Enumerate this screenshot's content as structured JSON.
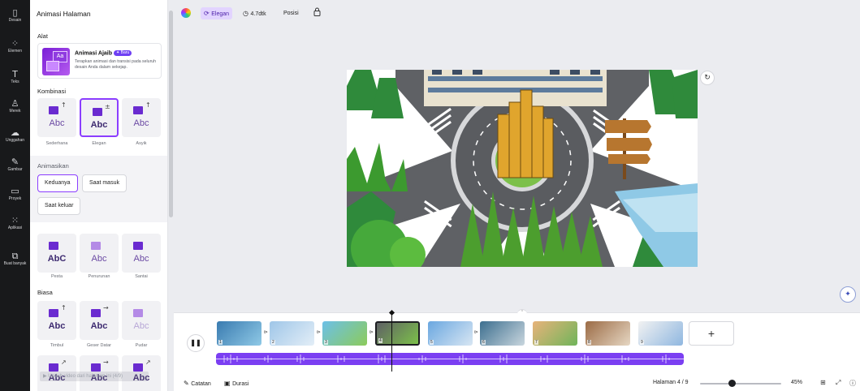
{
  "rail": [
    {
      "icon": "▯",
      "label": "Desain"
    },
    {
      "icon": "⁘",
      "label": "Elemen"
    },
    {
      "icon": "T",
      "label": "Teks"
    },
    {
      "icon": "♙",
      "label": "Merek"
    },
    {
      "icon": "☁",
      "label": "Unggahan"
    },
    {
      "icon": "✎",
      "label": "Gambar"
    },
    {
      "icon": "▭",
      "label": "Proyek"
    },
    {
      "icon": "⁙",
      "label": "Aplikasi"
    },
    {
      "icon": "⧉",
      "label": "Buat banyak"
    }
  ],
  "panel": {
    "title": "Animasi Halaman",
    "alat_label": "Alat",
    "magic": {
      "title": "Animasi Ajaib",
      "badge": "✦ Baru",
      "desc": "Terapkan animasi dan transisi pada seluruh desain Anda dalam sekejap."
    },
    "kombinasi_label": "Kombinasi",
    "kombinasi": [
      {
        "abc": "Abc",
        "label": "Sederhana",
        "arrow": "↑"
      },
      {
        "abc": "Abc",
        "label": "Elegan",
        "arrow": "±"
      },
      {
        "abc": "Abc",
        "label": "Asyik",
        "arrow": "↑"
      }
    ],
    "animasikan_label": "Animasikan",
    "animasikan": [
      "Keduanya",
      "Saat masuk",
      "Saat keluar"
    ],
    "group2": [
      {
        "abc": "AbC",
        "label": "Pesta"
      },
      {
        "abc": "Abc",
        "label": "Penurunan"
      },
      {
        "abc": "Abc",
        "label": "Santai"
      }
    ],
    "biasa_label": "Biasa",
    "biasa": [
      {
        "abc": "Abc",
        "label": "Timbul",
        "arrow": "↑"
      },
      {
        "abc": "Abc",
        "label": "Geser Datar",
        "arrow": "→"
      },
      {
        "abc": "Abc",
        "label": "Pudar",
        "arrow": ""
      }
    ],
    "biasa_row2": [
      {
        "abc": "Abc",
        "arrow": "↗"
      },
      {
        "abc": "Abc",
        "arrow": "→"
      },
      {
        "abc": "Abc",
        "arrow": "↗"
      }
    ],
    "toast": "▶ Unduh video dari halaman ini (4/9)"
  },
  "toolbar": {
    "style_label": "Elegan",
    "duration_label": "4.7dtk",
    "position_label": "Posisi",
    "lock_icon": "lock-icon"
  },
  "timeline": {
    "pages": [
      "1",
      "2",
      "3",
      "4",
      "5",
      "6",
      "7",
      "8",
      "9"
    ],
    "transition_glyph": "⊳",
    "play_glyph": "❚❚",
    "add_glyph": "+",
    "notes_label": "Catatan",
    "duration_label": "Durasi",
    "page_indicator": "Halaman 4 / 9",
    "zoom": "45%",
    "zoom_fraction": 0.35
  },
  "colors": {
    "accent": "#8b3dff",
    "audio": "#7b3ff2",
    "rail": "#18191b"
  }
}
